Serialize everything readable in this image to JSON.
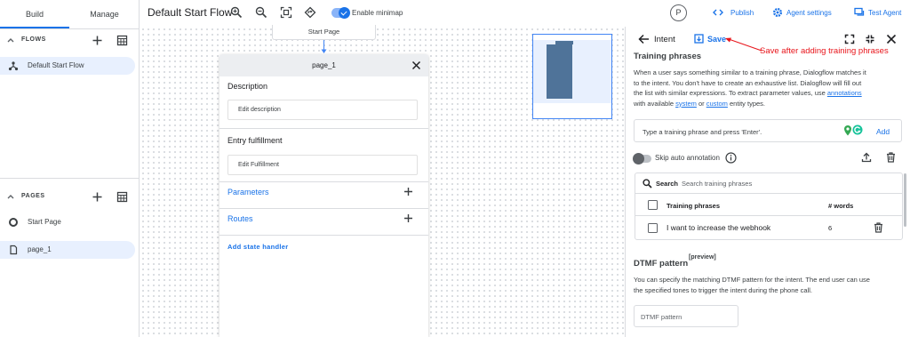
{
  "sidebar": {
    "tabs": [
      {
        "label": "Build"
      },
      {
        "label": "Manage"
      }
    ],
    "flows": {
      "title": "FLOWS",
      "items": [
        {
          "label": "Default Start Flow"
        }
      ]
    },
    "pages": {
      "title": "PAGES",
      "items": [
        {
          "label": "Start Page"
        },
        {
          "label": "page_1"
        }
      ]
    }
  },
  "toolbar": {
    "flow_title": "Default Start Flow",
    "minimap_label": "Enable minimap",
    "avatar_initial": "P",
    "publish_label": "Publish",
    "agent_settings_label": "Agent settings",
    "test_agent_label": "Test Agent"
  },
  "canvas": {
    "start_node": "Start Page",
    "page_card": {
      "title": "page_1",
      "description_label": "Description",
      "description_placeholder": "Edit description",
      "entry_label": "Entry fulfillment",
      "entry_placeholder": "Edit Fulfillment",
      "parameters_label": "Parameters",
      "routes_label": "Routes",
      "add_state_handler": "Add state handler"
    }
  },
  "panel": {
    "title": "Intent",
    "save_label": "Save",
    "annotation": "Save after adding training phrases",
    "section_title": "Training phrases",
    "desc_1": "When a user says something similar to a training phrase, Dialogflow matches it",
    "desc_2": "to the intent. You don't have to create an exhaustive list. Dialogflow will fill out",
    "desc_3_pre": "the list with similar expressions. To extract parameter values, use ",
    "desc_3_link": "annotations",
    "desc_4_pre": "with available ",
    "desc_4_link1": "system",
    "desc_4_mid": " or ",
    "desc_4_link2": "custom",
    "desc_4_post": " entity types.",
    "input_placeholder": "Type a training phrase and press 'Enter'.",
    "add_label": "Add",
    "skip_label": "Skip auto annotation",
    "search_label": "Search",
    "search_placeholder": "Search training phrases",
    "col_phrases": "Training phrases",
    "col_words": "# words",
    "rows": [
      {
        "phrase": "I want to increase the webhook",
        "words": "6"
      }
    ],
    "dtmf_title": "DTMF pattern",
    "dtmf_badge": "[preview]",
    "dtmf_desc_1": "You can specify the matching DTMF pattern for the intent. The end user can use",
    "dtmf_desc_2": "the specified tones to trigger the intent during the phone call.",
    "dtmf_placeholder": "DTMF pattern"
  },
  "colors": {
    "accent": "#1a73e8",
    "annotation": "#e8151b",
    "minimap_node": "#4f7399"
  }
}
